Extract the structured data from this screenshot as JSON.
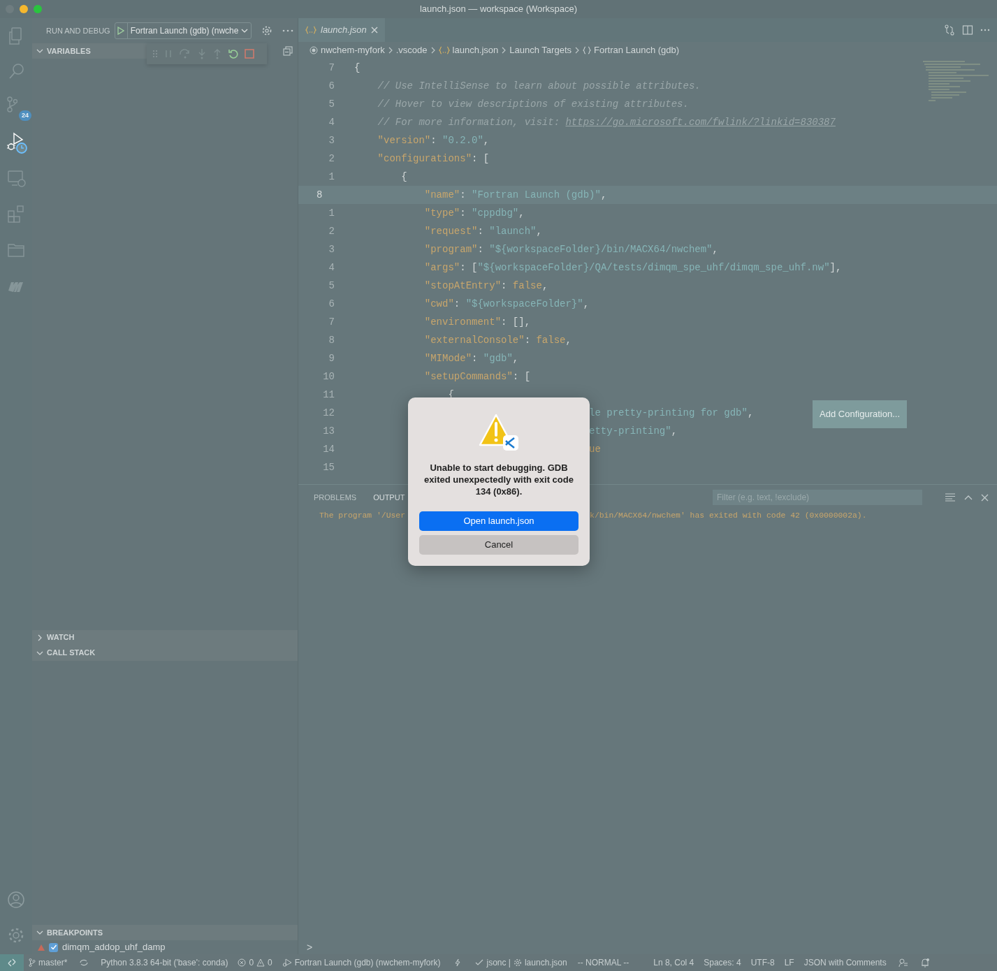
{
  "window": {
    "title": "launch.json — workspace (Workspace)"
  },
  "activity_bar": {
    "items": [
      {
        "selected": false
      },
      {
        "selected": false
      },
      {
        "selected": false,
        "badge": "24"
      },
      {
        "selected": true
      },
      {
        "selected": false
      },
      {
        "selected": false
      },
      {
        "selected": false
      },
      {
        "selected": false
      }
    ]
  },
  "sidebar": {
    "title": "RUN AND DEBUG",
    "launch_config": "Fortran Launch (gdb) (nwche",
    "sections": [
      {
        "title": "VARIABLES",
        "expanded": true
      },
      {
        "title": "WATCH",
        "expanded": false
      },
      {
        "title": "CALL STACK",
        "expanded": true
      },
      {
        "title": "BREAKPOINTS",
        "expanded": true
      }
    ],
    "breakpoints": [
      {
        "label": "dimqm_addop_uhf_damp",
        "checked": true
      }
    ]
  },
  "editor": {
    "tab": {
      "label": "launch.json",
      "selected": true
    },
    "breadcrumbs": [
      {
        "kind": "folder",
        "text": "nwchem-myfork"
      },
      {
        "kind": "plain",
        "text": ".vscode"
      },
      {
        "kind": "json",
        "text": "launch.json"
      },
      {
        "kind": "plain",
        "text": "Launch Targets"
      },
      {
        "kind": "object",
        "text": "Fortran Launch (gdb)"
      }
    ],
    "lines": [
      {
        "number": "7",
        "current": false,
        "tokens": [
          {
            "kind": "punct",
            "text": "{"
          }
        ]
      },
      {
        "number": "6",
        "current": false,
        "tokens": [
          {
            "kind": "comment",
            "text": "    // Use IntelliSense to learn about possible attributes."
          }
        ]
      },
      {
        "number": "5",
        "current": false,
        "tokens": [
          {
            "kind": "comment",
            "text": "    // Hover to view descriptions of existing attributes."
          }
        ]
      },
      {
        "number": "4",
        "current": false,
        "tokens": [
          {
            "kind": "comment",
            "text": "    // For more information, visit: "
          },
          {
            "kind": "link",
            "text": "https://go.microsoft.com/fwlink/?linkid=830387"
          }
        ]
      },
      {
        "number": "3",
        "current": false,
        "tokens": [
          {
            "kind": "key",
            "text": "    \"version\""
          },
          {
            "kind": "punct",
            "text": ": "
          },
          {
            "kind": "string",
            "text": "\"0.2.0\""
          },
          {
            "kind": "punct",
            "text": ","
          }
        ]
      },
      {
        "number": "2",
        "current": false,
        "tokens": [
          {
            "kind": "key",
            "text": "    \"configurations\""
          },
          {
            "kind": "punct",
            "text": ": ["
          }
        ]
      },
      {
        "number": "1",
        "current": false,
        "tokens": [
          {
            "kind": "punct",
            "text": "        {"
          }
        ]
      },
      {
        "number": "8",
        "current": true,
        "tokens": [
          {
            "kind": "key",
            "text": "            \"name\""
          },
          {
            "kind": "punct",
            "text": ": "
          },
          {
            "kind": "string",
            "text": "\"Fortran Launch (gdb)\""
          },
          {
            "kind": "punct",
            "text": ","
          }
        ]
      },
      {
        "number": "1",
        "current": false,
        "tokens": [
          {
            "kind": "key",
            "text": "            \"type\""
          },
          {
            "kind": "punct",
            "text": ": "
          },
          {
            "kind": "string",
            "text": "\"cppdbg\""
          },
          {
            "kind": "punct",
            "text": ","
          }
        ]
      },
      {
        "number": "2",
        "current": false,
        "tokens": [
          {
            "kind": "key",
            "text": "            \"request\""
          },
          {
            "kind": "punct",
            "text": ": "
          },
          {
            "kind": "string",
            "text": "\"launch\""
          },
          {
            "kind": "punct",
            "text": ","
          }
        ]
      },
      {
        "number": "3",
        "current": false,
        "tokens": [
          {
            "kind": "key",
            "text": "            \"program\""
          },
          {
            "kind": "punct",
            "text": ": "
          },
          {
            "kind": "string",
            "text": "\"${workspaceFolder}/bin/MACX64/nwchem\""
          },
          {
            "kind": "punct",
            "text": ","
          }
        ]
      },
      {
        "number": "4",
        "current": false,
        "tokens": [
          {
            "kind": "key",
            "text": "            \"args\""
          },
          {
            "kind": "punct",
            "text": ": ["
          },
          {
            "kind": "string",
            "text": "\"${workspaceFolder}/QA/tests/dimqm_spe_uhf/dimqm_spe_uhf.nw\""
          },
          {
            "kind": "punct",
            "text": "],"
          }
        ]
      },
      {
        "number": "5",
        "current": false,
        "tokens": [
          {
            "kind": "key",
            "text": "            \"stopAtEntry\""
          },
          {
            "kind": "punct",
            "text": ": "
          },
          {
            "kind": "bool",
            "text": "false"
          },
          {
            "kind": "punct",
            "text": ","
          }
        ]
      },
      {
        "number": "6",
        "current": false,
        "tokens": [
          {
            "kind": "key",
            "text": "            \"cwd\""
          },
          {
            "kind": "punct",
            "text": ": "
          },
          {
            "kind": "string",
            "text": "\"${workspaceFolder}\""
          },
          {
            "kind": "punct",
            "text": ","
          }
        ]
      },
      {
        "number": "7",
        "current": false,
        "tokens": [
          {
            "kind": "key",
            "text": "            \"environment\""
          },
          {
            "kind": "punct",
            "text": ": [],"
          }
        ]
      },
      {
        "number": "8",
        "current": false,
        "tokens": [
          {
            "kind": "key",
            "text": "            \"externalConsole\""
          },
          {
            "kind": "punct",
            "text": ": "
          },
          {
            "kind": "bool",
            "text": "false"
          },
          {
            "kind": "punct",
            "text": ","
          }
        ]
      },
      {
        "number": "9",
        "current": false,
        "tokens": [
          {
            "kind": "key",
            "text": "            \"MIMode\""
          },
          {
            "kind": "punct",
            "text": ": "
          },
          {
            "kind": "string",
            "text": "\"gdb\""
          },
          {
            "kind": "punct",
            "text": ","
          }
        ]
      },
      {
        "number": "10",
        "current": false,
        "tokens": [
          {
            "kind": "key",
            "text": "            \"setupCommands\""
          },
          {
            "kind": "punct",
            "text": ": ["
          }
        ]
      },
      {
        "number": "11",
        "current": false,
        "tokens": [
          {
            "kind": "punct",
            "text": "                {"
          }
        ]
      },
      {
        "number": "12",
        "current": false,
        "tokens": [
          {
            "kind": "string",
            "text": "                                        le pretty-printing for gdb\""
          },
          {
            "kind": "punct",
            "text": ","
          }
        ]
      },
      {
        "number": "13",
        "current": false,
        "tokens": [
          {
            "kind": "string",
            "text": "                                        etty-printing\""
          },
          {
            "kind": "punct",
            "text": ","
          }
        ]
      },
      {
        "number": "14",
        "current": false,
        "tokens": [
          {
            "kind": "bool",
            "text": "                                        ue"
          }
        ]
      },
      {
        "number": "15",
        "current": false
      }
    ],
    "add_configuration_button": "Add Configuration..."
  },
  "panel": {
    "tabs": [
      {
        "label": "PROBLEMS",
        "selected": false
      },
      {
        "label": "OUTPUT",
        "selected": true
      }
    ],
    "filter": {
      "placeholder": "Filter (e.g. text, !exclude)"
    },
    "output_lines": [
      {
        "parts": [
          "The program '/User",
          "k/bin/MACX64/nwchem' has exited with code 42 (0x0000002a)."
        ]
      }
    ],
    "prompt": ">"
  },
  "dialog": {
    "message": "Unable to start debugging. GDB exited unexpectedly with exit code 134 (0x86).",
    "buttons": [
      {
        "label": "Open launch.json",
        "kind": "primary"
      },
      {
        "label": "Cancel",
        "kind": "secondary"
      }
    ]
  },
  "status_bar": {
    "branch": "master*",
    "python": "Python 3.8.3 64-bit ('base': conda)",
    "errors": "0",
    "warnings": "0",
    "debug_target": "Fortran Launch (gdb) (nwchem-myfork)",
    "linter": "jsonc |",
    "linter_file": "launch.json",
    "mode": "-- NORMAL --",
    "position": "Ln 8, Col 4",
    "spaces": "Spaces: 4",
    "encoding": "UTF-8",
    "eol": "LF",
    "language": "JSON with Comments"
  }
}
